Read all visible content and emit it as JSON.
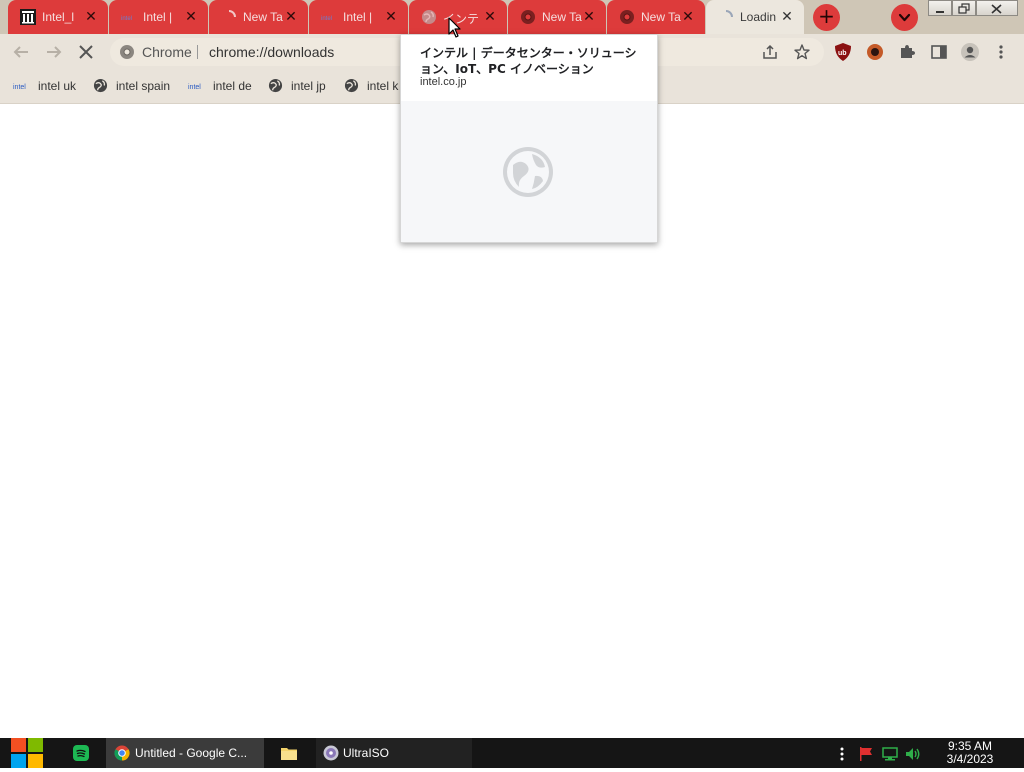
{
  "browser": {
    "tabs": [
      {
        "title": "Intel_l",
        "favicon": "intel-building-icon",
        "active": false
      },
      {
        "title": "Intel | ",
        "favicon": "intel-logo-icon",
        "active": false
      },
      {
        "title": "New Ta",
        "favicon": "loading-spinner-icon",
        "active": false
      },
      {
        "title": "Intel | ",
        "favicon": "intel-logo-icon",
        "active": false
      },
      {
        "title": "インテ",
        "favicon": "globe-icon",
        "active": false
      },
      {
        "title": "New Ta",
        "favicon": "chrome-icon",
        "active": false
      },
      {
        "title": "New Ta",
        "favicon": "chrome-icon",
        "active": false
      },
      {
        "title": "Loadin",
        "favicon": "loading-spinner-icon",
        "active": true
      }
    ],
    "tab_close_glyph": "✕",
    "new_tab_glyph": "+",
    "omnibox": {
      "site_label": "Chrome",
      "url": "chrome://downloads"
    },
    "bookmarks": [
      {
        "label": "intel uk",
        "favicon": "intel-logo-icon"
      },
      {
        "label": "intel spain",
        "favicon": "globe-icon"
      },
      {
        "label": "intel de",
        "favicon": "intel-logo-icon"
      },
      {
        "label": "intel jp",
        "favicon": "globe-icon"
      },
      {
        "label": "intel k",
        "favicon": "globe-icon"
      }
    ],
    "hover_card": {
      "title": "インテル | データセンター・ソリューション、IoT、PC イノベーション",
      "domain": "intel.co.jp"
    },
    "colors": {
      "tab_red": "#dd3b3b",
      "frame": "#cfc6b6",
      "toolbar": "#e9e3da"
    }
  },
  "taskbar": {
    "items": [
      {
        "label": "Untitled - Google C...",
        "icon": "chrome-icon",
        "active": true
      },
      {
        "label": "",
        "icon": "folder-icon",
        "active": false
      },
      {
        "label": "UltraISO",
        "icon": "ultraiso-disc-icon",
        "active": false
      }
    ],
    "clock": {
      "time": "9:35 AM",
      "date": "3/4/2023"
    }
  }
}
